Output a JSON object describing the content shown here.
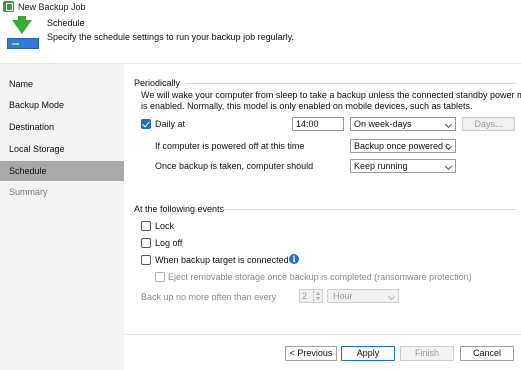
{
  "window": {
    "title": "New Backup Job",
    "icon": "backup-app-icon"
  },
  "header": {
    "step": "Schedule",
    "description": "Specify the schedule settings to run your backup job regularly.",
    "icon": "backup-to-drive-icon"
  },
  "sidebar": {
    "items": [
      {
        "label": "Name",
        "state": "normal"
      },
      {
        "label": "Backup Mode",
        "state": "normal"
      },
      {
        "label": "Destination",
        "state": "normal"
      },
      {
        "label": "Local Storage",
        "state": "normal"
      },
      {
        "label": "Schedule",
        "state": "active"
      },
      {
        "label": "Summary",
        "state": "disabled"
      }
    ]
  },
  "periodically": {
    "group_label": "Periodically",
    "note_line1": "We will wake your computer from sleep to take a backup unless the connected standby power model",
    "note_line2": "is enabled. Normally, this model is only enabled on mobile devices, such as tablets.",
    "daily_label": "Daily at",
    "daily_checked": true,
    "time_value": "14:00",
    "frequency_value": "On week-days",
    "days_button": "Days...",
    "powered_off_label": "If computer is powered off at this time",
    "powered_off_value": "Backup once powered c",
    "after_backup_label": "Once backup is taken, computer should",
    "after_backup_value": "Keep running"
  },
  "events": {
    "group_label": "At the following events",
    "lock_label": "Lock",
    "logoff_label": "Log off",
    "target_connected_label": "When backup target is connected",
    "eject_label": "Eject removable storage once backup is completed (ransomware protection)",
    "backup_no_more_label": "Back up no more often than every",
    "interval_value": "2",
    "interval_unit": "Hour"
  },
  "footer": {
    "previous": "< Previous",
    "apply": "Apply",
    "finish": "Finish",
    "cancel": "Cancel"
  },
  "colors": {
    "accent": "#1a6fd0",
    "sidebar_bg": "#f3f3f3",
    "sidebar_active": "#a9a9a9",
    "brand_green": "#3aa83a"
  }
}
